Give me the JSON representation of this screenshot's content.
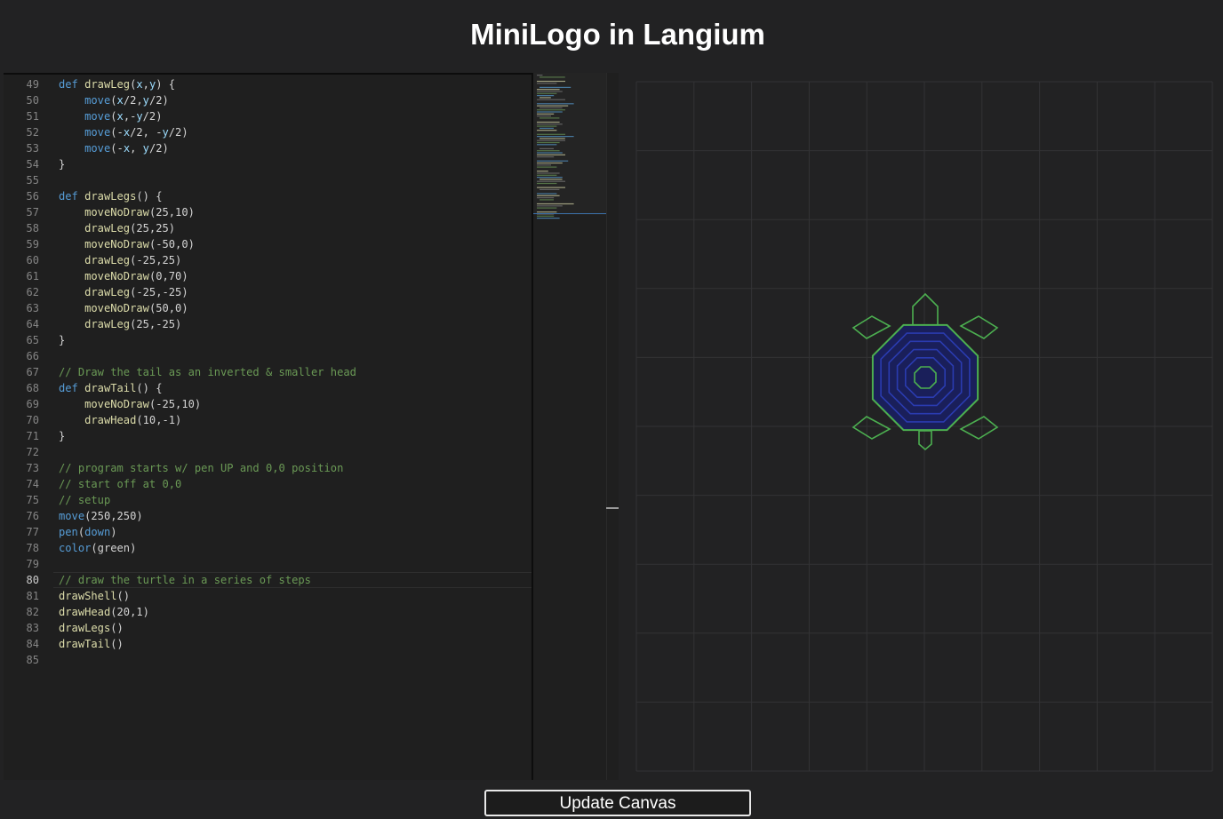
{
  "app": {
    "title": "MiniLogo in Langium"
  },
  "editor": {
    "current_line": 80,
    "lines": [
      {
        "n": 49,
        "tokens": [
          [
            "kw",
            "def "
          ],
          [
            "fn",
            "drawLeg"
          ],
          [
            "p",
            "("
          ],
          [
            "prm",
            "x"
          ],
          [
            "p",
            ","
          ],
          [
            "prm",
            "y"
          ],
          [
            "p",
            ") {"
          ]
        ]
      },
      {
        "n": 50,
        "tokens": [
          [
            "p",
            "    "
          ],
          [
            "kw",
            "move"
          ],
          [
            "p",
            "("
          ],
          [
            "prm",
            "x"
          ],
          [
            "p",
            "/2,"
          ],
          [
            "prm",
            "y"
          ],
          [
            "p",
            "/2)"
          ]
        ]
      },
      {
        "n": 51,
        "tokens": [
          [
            "p",
            "    "
          ],
          [
            "kw",
            "move"
          ],
          [
            "p",
            "("
          ],
          [
            "prm",
            "x"
          ],
          [
            "p",
            ",-"
          ],
          [
            "prm",
            "y"
          ],
          [
            "p",
            "/2)"
          ]
        ]
      },
      {
        "n": 52,
        "tokens": [
          [
            "p",
            "    "
          ],
          [
            "kw",
            "move"
          ],
          [
            "p",
            "(-"
          ],
          [
            "prm",
            "x"
          ],
          [
            "p",
            "/2, -"
          ],
          [
            "prm",
            "y"
          ],
          [
            "p",
            "/2)"
          ]
        ]
      },
      {
        "n": 53,
        "tokens": [
          [
            "p",
            "    "
          ],
          [
            "kw",
            "move"
          ],
          [
            "p",
            "(-"
          ],
          [
            "prm",
            "x"
          ],
          [
            "p",
            ", "
          ],
          [
            "prm",
            "y"
          ],
          [
            "p",
            "/2)"
          ]
        ]
      },
      {
        "n": 54,
        "tokens": [
          [
            "p",
            "}"
          ]
        ]
      },
      {
        "n": 55,
        "tokens": []
      },
      {
        "n": 56,
        "tokens": [
          [
            "kw",
            "def "
          ],
          [
            "fn",
            "drawLegs"
          ],
          [
            "p",
            "() {"
          ]
        ]
      },
      {
        "n": 57,
        "tokens": [
          [
            "p",
            "    "
          ],
          [
            "fn",
            "moveNoDraw"
          ],
          [
            "p",
            "(25,10)"
          ]
        ]
      },
      {
        "n": 58,
        "tokens": [
          [
            "p",
            "    "
          ],
          [
            "fn",
            "drawLeg"
          ],
          [
            "p",
            "(25,25)"
          ]
        ]
      },
      {
        "n": 59,
        "tokens": [
          [
            "p",
            "    "
          ],
          [
            "fn",
            "moveNoDraw"
          ],
          [
            "p",
            "(-50,0)"
          ]
        ]
      },
      {
        "n": 60,
        "tokens": [
          [
            "p",
            "    "
          ],
          [
            "fn",
            "drawLeg"
          ],
          [
            "p",
            "(-25,25)"
          ]
        ]
      },
      {
        "n": 61,
        "tokens": [
          [
            "p",
            "    "
          ],
          [
            "fn",
            "moveNoDraw"
          ],
          [
            "p",
            "(0,70)"
          ]
        ]
      },
      {
        "n": 62,
        "tokens": [
          [
            "p",
            "    "
          ],
          [
            "fn",
            "drawLeg"
          ],
          [
            "p",
            "(-25,-25)"
          ]
        ]
      },
      {
        "n": 63,
        "tokens": [
          [
            "p",
            "    "
          ],
          [
            "fn",
            "moveNoDraw"
          ],
          [
            "p",
            "(50,0)"
          ]
        ]
      },
      {
        "n": 64,
        "tokens": [
          [
            "p",
            "    "
          ],
          [
            "fn",
            "drawLeg"
          ],
          [
            "p",
            "(25,-25)"
          ]
        ]
      },
      {
        "n": 65,
        "tokens": [
          [
            "p",
            "}"
          ]
        ]
      },
      {
        "n": 66,
        "tokens": []
      },
      {
        "n": 67,
        "tokens": [
          [
            "cmt",
            "// Draw the tail as an inverted & smaller head"
          ]
        ]
      },
      {
        "n": 68,
        "tokens": [
          [
            "kw",
            "def "
          ],
          [
            "fn",
            "drawTail"
          ],
          [
            "p",
            "() {"
          ]
        ]
      },
      {
        "n": 69,
        "tokens": [
          [
            "p",
            "    "
          ],
          [
            "fn",
            "moveNoDraw"
          ],
          [
            "p",
            "(-25,10)"
          ]
        ]
      },
      {
        "n": 70,
        "tokens": [
          [
            "p",
            "    "
          ],
          [
            "fn",
            "drawHead"
          ],
          [
            "p",
            "(10,-1)"
          ]
        ]
      },
      {
        "n": 71,
        "tokens": [
          [
            "p",
            "}"
          ]
        ]
      },
      {
        "n": 72,
        "tokens": []
      },
      {
        "n": 73,
        "tokens": [
          [
            "cmt",
            "// program starts w/ pen UP and 0,0 position"
          ]
        ]
      },
      {
        "n": 74,
        "tokens": [
          [
            "cmt",
            "// start off at 0,0"
          ]
        ]
      },
      {
        "n": 75,
        "tokens": [
          [
            "cmt",
            "// setup"
          ]
        ]
      },
      {
        "n": 76,
        "tokens": [
          [
            "kw",
            "move"
          ],
          [
            "p",
            "(250,250)"
          ]
        ]
      },
      {
        "n": 77,
        "tokens": [
          [
            "kw",
            "pen"
          ],
          [
            "p",
            "("
          ],
          [
            "kw",
            "down"
          ],
          [
            "p",
            ")"
          ]
        ]
      },
      {
        "n": 78,
        "tokens": [
          [
            "kw",
            "color"
          ],
          [
            "p",
            "(green)"
          ]
        ]
      },
      {
        "n": 79,
        "tokens": []
      },
      {
        "n": 80,
        "tokens": [
          [
            "cmt",
            "// draw the turtle in a series of steps"
          ]
        ]
      },
      {
        "n": 81,
        "tokens": [
          [
            "fn",
            "drawShell"
          ],
          [
            "p",
            "()"
          ]
        ]
      },
      {
        "n": 82,
        "tokens": [
          [
            "fn",
            "drawHead"
          ],
          [
            "p",
            "(20,1)"
          ]
        ]
      },
      {
        "n": 83,
        "tokens": [
          [
            "fn",
            "drawLegs"
          ],
          [
            "p",
            "()"
          ]
        ]
      },
      {
        "n": 84,
        "tokens": [
          [
            "fn",
            "drawTail"
          ],
          [
            "p",
            "()"
          ]
        ]
      },
      {
        "n": 85,
        "tokens": []
      }
    ]
  },
  "canvas": {
    "background": "#222223",
    "grid_color": "#333335",
    "turtle_outline_color": "#4caf50",
    "shell_inner_color": "#2a3bb0",
    "fill_color": "#1a1f5a"
  },
  "actions": {
    "update_label": "Update Canvas"
  },
  "colors": {
    "keyword": "#569cd6",
    "function": "#dcdcaa",
    "parameter": "#9cdcfe",
    "comment": "#6a9955",
    "text": "#d4d4d4"
  }
}
